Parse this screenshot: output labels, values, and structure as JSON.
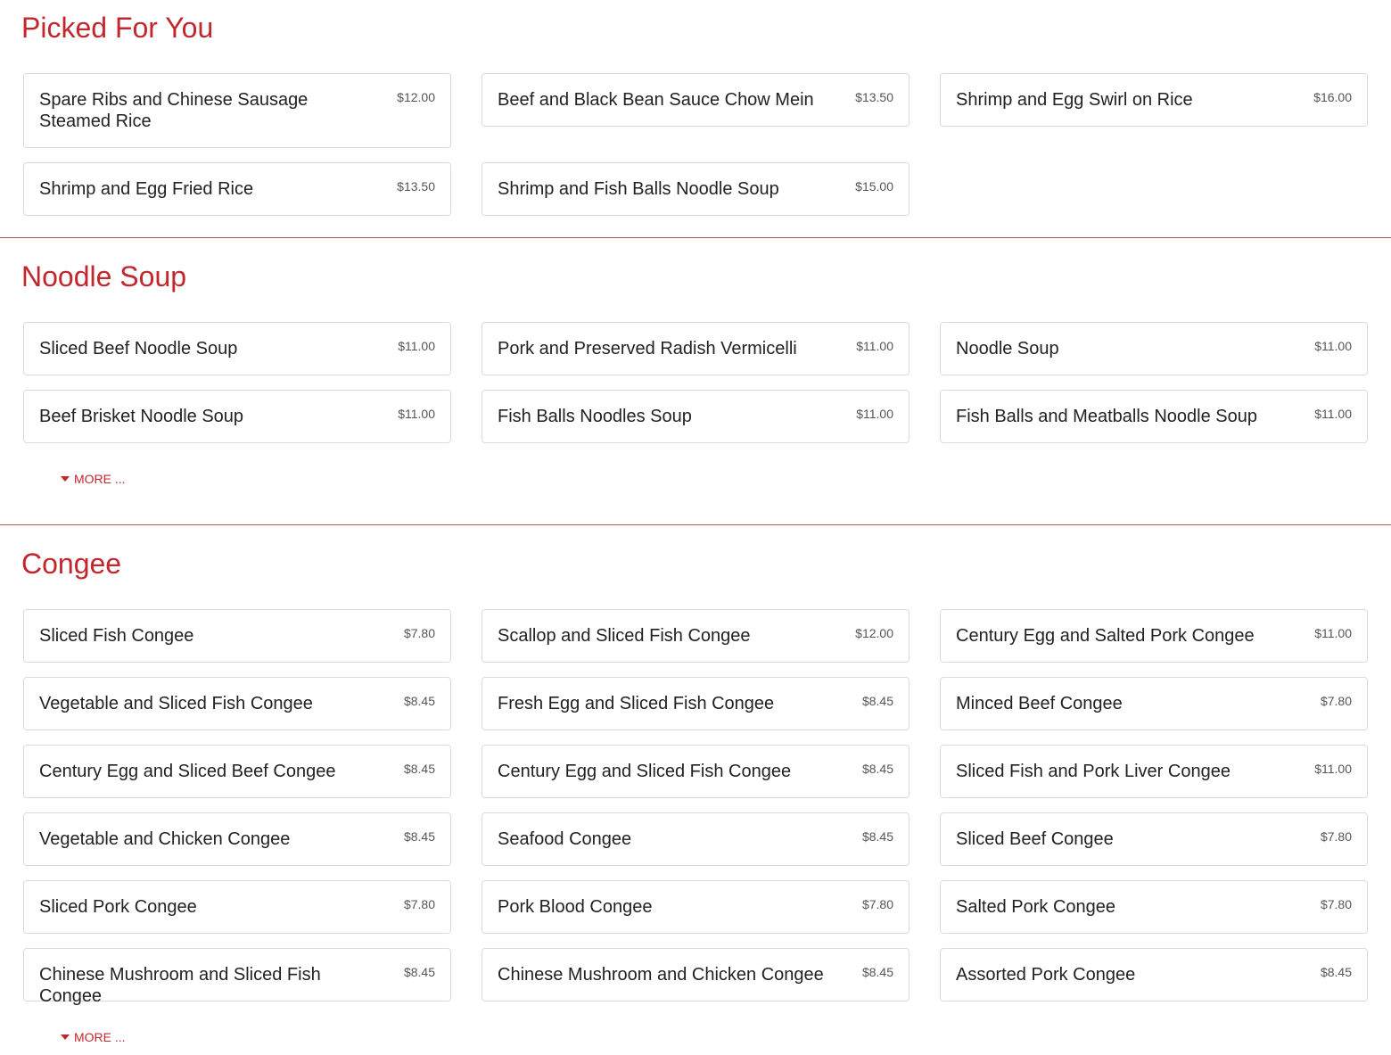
{
  "sections": [
    {
      "title": "Picked For You",
      "items": [
        {
          "name": "Spare Ribs and Chinese Sausage Steamed Rice",
          "price": "$12.00"
        },
        {
          "name": "Beef and Black Bean Sauce Chow Mein",
          "price": "$13.50"
        },
        {
          "name": "Shrimp and Egg Swirl on Rice",
          "price": "$16.00"
        },
        {
          "name": "Shrimp and Egg Fried Rice",
          "price": "$13.50"
        },
        {
          "name": "Shrimp and Fish Balls Noodle Soup",
          "price": "$15.00"
        }
      ]
    },
    {
      "title": "Noodle Soup",
      "items": [
        {
          "name": "Sliced Beef Noodle Soup",
          "price": "$11.00"
        },
        {
          "name": "Pork and Preserved Radish Vermicelli",
          "price": "$11.00"
        },
        {
          "name": "Noodle Soup",
          "price": "$11.00"
        },
        {
          "name": "Beef Brisket Noodle Soup",
          "price": "$11.00"
        },
        {
          "name": "Fish Balls Noodles Soup",
          "price": "$11.00"
        },
        {
          "name": "Fish Balls and Meatballs Noodle Soup",
          "price": "$11.00"
        }
      ],
      "more_label": "MORE ..."
    },
    {
      "title": "Congee",
      "items": [
        {
          "name": "Sliced Fish Congee",
          "price": "$7.80"
        },
        {
          "name": "Scallop and Sliced Fish Congee",
          "price": "$12.00"
        },
        {
          "name": "Century Egg and Salted Pork Congee",
          "price": "$11.00"
        },
        {
          "name": "Vegetable and Sliced Fish Congee",
          "price": "$8.45"
        },
        {
          "name": "Fresh Egg and Sliced Fish Congee",
          "price": "$8.45"
        },
        {
          "name": "Minced Beef Congee",
          "price": "$7.80"
        },
        {
          "name": "Century Egg and Sliced Beef Congee",
          "price": "$8.45"
        },
        {
          "name": "Century Egg and Sliced Fish Congee",
          "price": "$8.45"
        },
        {
          "name": "Sliced Fish and Pork Liver Congee",
          "price": "$11.00"
        },
        {
          "name": "Vegetable and Chicken Congee",
          "price": "$8.45"
        },
        {
          "name": "Seafood Congee",
          "price": "$8.45"
        },
        {
          "name": "Sliced Beef Congee",
          "price": "$7.80"
        },
        {
          "name": "Sliced Pork Congee",
          "price": "$7.80"
        },
        {
          "name": "Pork Blood Congee",
          "price": "$7.80"
        },
        {
          "name": "Salted Pork Congee",
          "price": "$7.80"
        },
        {
          "name": "Chinese Mushroom and Sliced Fish Congee",
          "price": "$8.45"
        },
        {
          "name": "Chinese Mushroom and Chicken Congee",
          "price": "$8.45"
        },
        {
          "name": "Assorted Pork Congee",
          "price": "$8.45"
        }
      ],
      "more_label": "MORE ..."
    }
  ],
  "colors": {
    "accent": "#c1272d",
    "card_border": "#dadada",
    "divider": "#b5585a"
  },
  "icons": {
    "more": "caret-down-icon"
  }
}
